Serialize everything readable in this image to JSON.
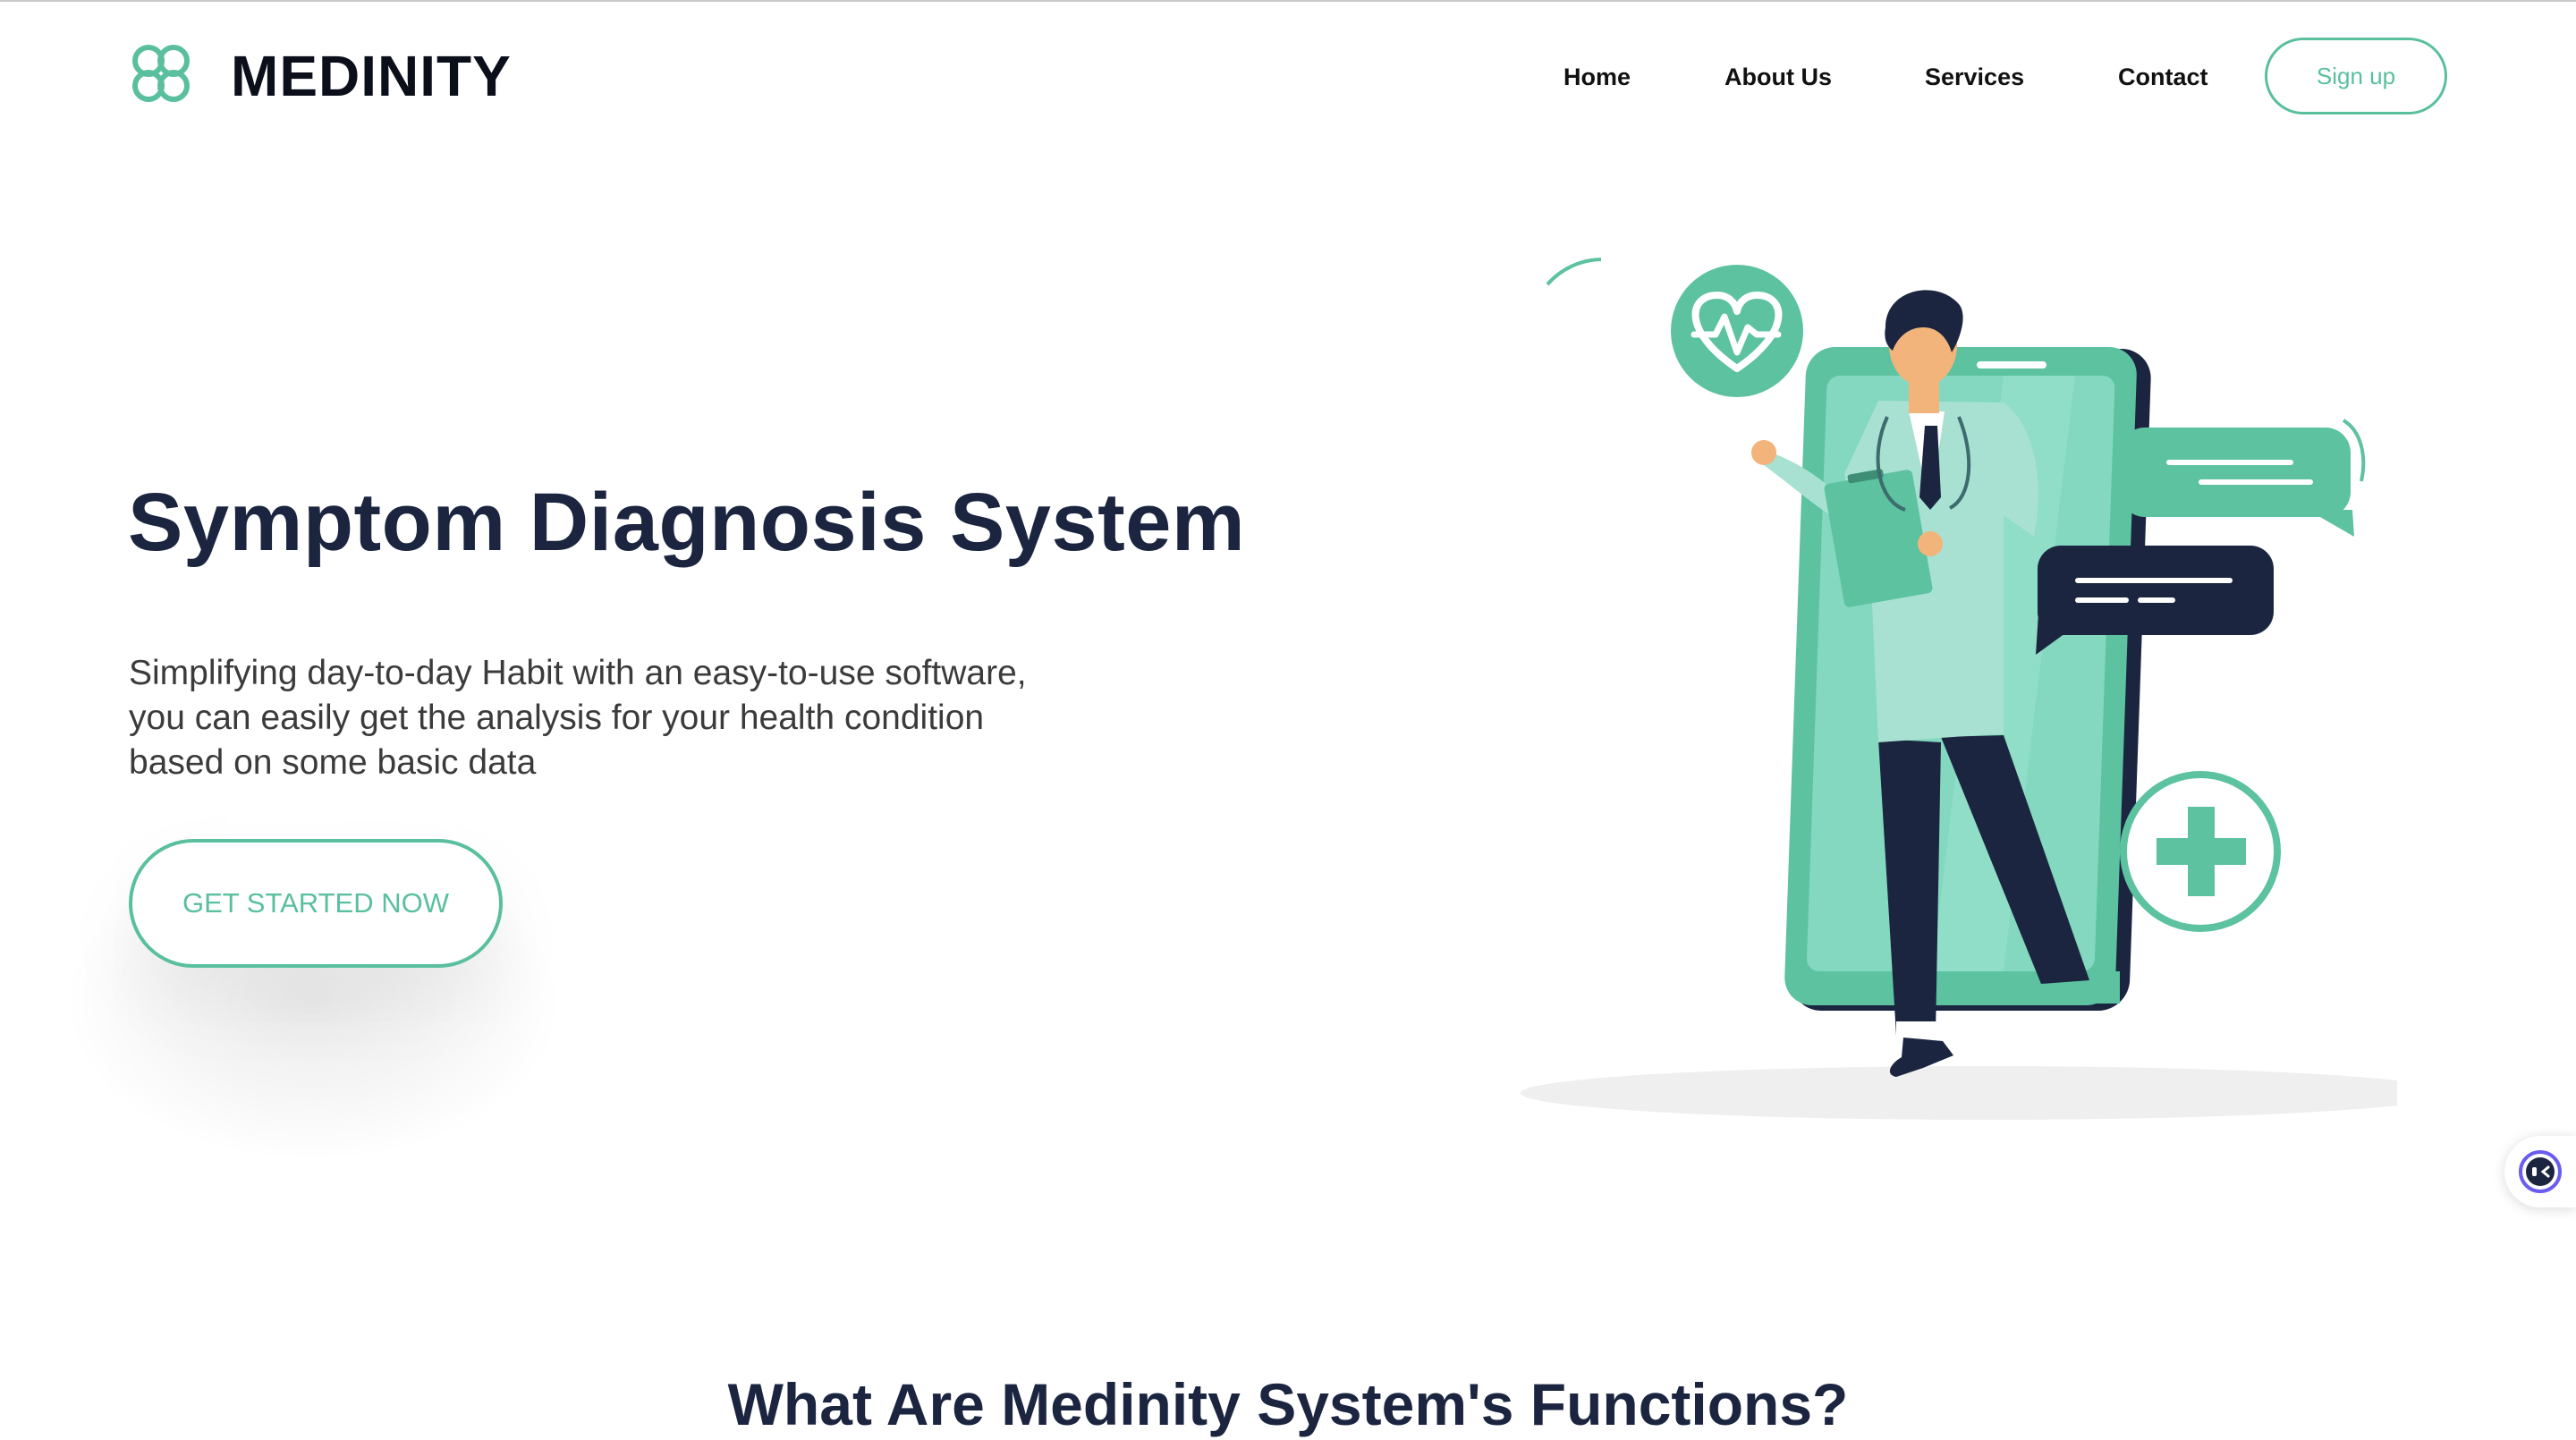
{
  "brand": {
    "name": "MEDINITY",
    "logo_icon": "flower-logo-icon",
    "accent_color": "#59bf9f",
    "text_color": "#1b2540"
  },
  "nav": {
    "items": [
      {
        "label": "Home"
      },
      {
        "label": "About Us"
      },
      {
        "label": "Services"
      },
      {
        "label": "Contact"
      }
    ],
    "signup_label": "Sign up"
  },
  "hero": {
    "title": "Symptom Diagnosis System",
    "description": "Simplifying day-to-day Habit with an easy-to-use software, you can easily get the analysis for your health condition based on some basic data",
    "cta_label": "GET STARTED NOW",
    "illustration": "doctor-with-phone-illustration"
  },
  "section": {
    "title": "What Are Medinity System's Functions?"
  },
  "widget": {
    "icon": "assistant-face-icon"
  }
}
